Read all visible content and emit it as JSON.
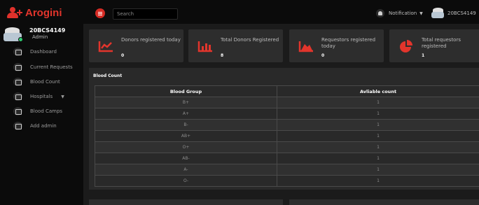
{
  "brand": {
    "title": "Arogini"
  },
  "topbar": {
    "search_placeholder": "Search",
    "notification_label": "Notification",
    "user_label": "20BCS4149"
  },
  "sidebar": {
    "user": {
      "name": "20BCS4149",
      "role": "Admin"
    },
    "items": [
      {
        "label": "Dashboard",
        "icon": "dashboard-icon"
      },
      {
        "label": "Current Requests",
        "icon": "monitor-icon"
      },
      {
        "label": "Blood Count",
        "icon": "grid-icon"
      },
      {
        "label": "Hospitals",
        "icon": "hospital-icon",
        "has_dropdown": true
      },
      {
        "label": "Blood Camps",
        "icon": "calendar-icon"
      },
      {
        "label": "Add admin",
        "icon": "user-add-icon"
      }
    ]
  },
  "cards": [
    {
      "label": "Donors registered today",
      "value": "0",
      "icon": "line-chart-icon"
    },
    {
      "label": "Total Donors Registered",
      "value": "8",
      "icon": "bar-chart-icon"
    },
    {
      "label": "Requestors registered today",
      "value": "0",
      "icon": "area-chart-icon"
    },
    {
      "label": "Total requestors registered",
      "value": "1",
      "icon": "pie-chart-icon"
    }
  ],
  "blood_count": {
    "title": "Blood Count",
    "headers": [
      "Blood Group",
      "Avliable count"
    ],
    "rows": [
      [
        "B+",
        "1"
      ],
      [
        "A+",
        "1"
      ],
      [
        "B-",
        "1"
      ],
      [
        "AB+",
        "1"
      ],
      [
        "O+",
        "1"
      ],
      [
        "AB-",
        "1"
      ],
      [
        "A-",
        "1"
      ],
      [
        "O-",
        "1"
      ]
    ]
  },
  "colors": {
    "brand_red": "#e2352c",
    "background": "#0b0b0b",
    "panel": "#292929"
  }
}
